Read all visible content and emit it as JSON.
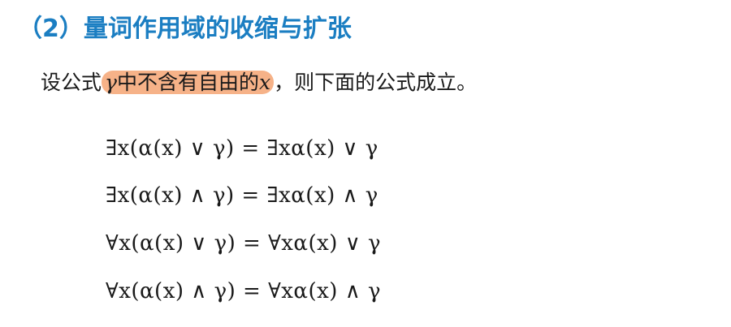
{
  "heading": "（2）量词作用域的收缩与扩张",
  "intro": {
    "before": "设公式",
    "gamma": "γ",
    "highlight_text": "中不含有自由的",
    "x": "x",
    "after": "，则下面的公式成立。"
  },
  "formulas": [
    "∃x(α(x) ∨ γ) = ∃xα(x) ∨ γ",
    "∃x(α(x) ∧ γ) = ∃xα(x) ∧ γ",
    "∀x(α(x) ∨ γ) = ∀xα(x) ∨ γ",
    "∀x(α(x) ∧ γ) = ∀xα(x) ∧ γ"
  ],
  "colors": {
    "heading": "#1b7ec2",
    "highlight": "#f6b288",
    "text": "#1a1a1a"
  }
}
